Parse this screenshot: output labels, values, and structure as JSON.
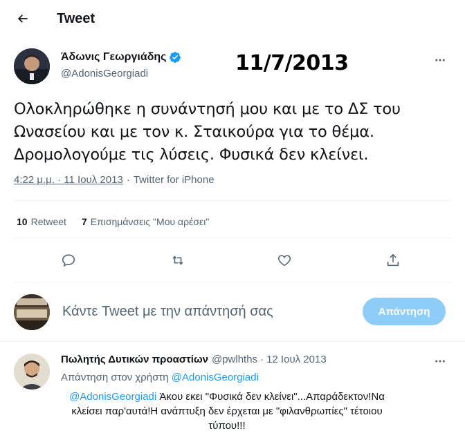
{
  "header": {
    "title": "Tweet",
    "back_icon": "arrow-left-icon"
  },
  "tweet": {
    "author_name": "Άδωνις Γεωργιάδης",
    "author_handle": "@AdonisGeorgiadi",
    "verified": true,
    "annotation_date": "11/7/2013",
    "text": "Ολοκληρώθηκε η συνάντησή μου και με το ΔΣ του Ωνασείου και με τον κ. Σταικούρα για το θέμα. Δρομολογούμε τις λύσεις. Φυσικά δεν κλείνει.",
    "timestamp": "4:22 μ.μ. · 11 Ιουλ 2013",
    "separator": "·",
    "source": "Twitter for iPhone",
    "retweets_count": "10",
    "retweets_label": "Retweet",
    "likes_count": "7",
    "likes_label": "Επισημάνσεις \"Μου αρέσει\""
  },
  "actions": [
    "reply-icon",
    "retweet-icon",
    "like-icon",
    "share-icon"
  ],
  "compose": {
    "placeholder": "Κάντε Tweet με την απάντησή σας",
    "button_label": "Απάντηση",
    "button_color": "#8ecdf8"
  },
  "reply": {
    "name": "Πωλητής Δυτικών προαστίων",
    "handle": "@pwlhths",
    "dot": "·",
    "date": "12 Ιουλ 2013",
    "replying_prefix": "Απάντηση στον χρήστη",
    "replying_to": "@AdonisGeorgiadi",
    "mention": "@AdonisGeorgiadi",
    "text": " Άκου εκει \"Φυσικά δεν κλείνει\"...Απαράδεκτον!Να κλείσει παρ'αυτά!Η ανάπτυξη δεν έρχεται με \"φιλανθρωπίες\" τέτοιου τύπου!!!"
  },
  "colors": {
    "accent": "#1d9bf0",
    "muted_text": "#536471",
    "primary_text": "#0f1419"
  }
}
